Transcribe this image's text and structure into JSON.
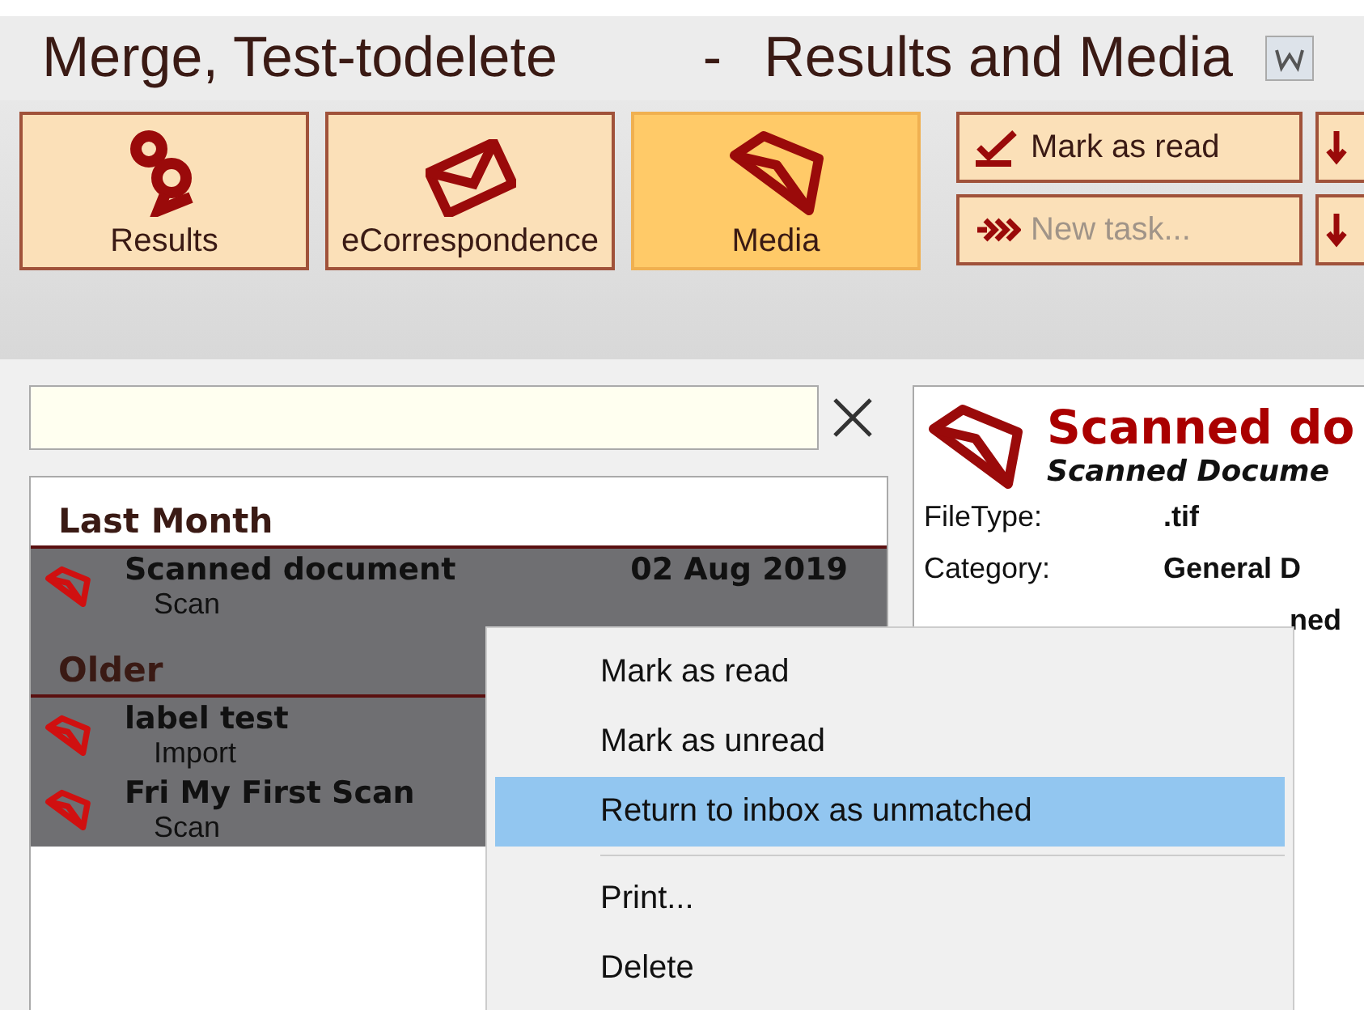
{
  "window": {
    "title": "Merge, Test-todelete",
    "subtitle": "Results and Media",
    "separator": "-"
  },
  "toolbar": {
    "big_buttons": [
      {
        "label": "Results",
        "selected": false
      },
      {
        "label": "eCorrespondence",
        "selected": false
      },
      {
        "label": "Media",
        "selected": true
      }
    ],
    "small_buttons": [
      {
        "label": "Mark as read",
        "disabled": false
      },
      {
        "label": "New task...",
        "disabled": true
      }
    ]
  },
  "list": {
    "sections": [
      {
        "title": "Last Month",
        "highlighted": false,
        "items": [
          {
            "title": "Scanned document",
            "subtitle": "Scan",
            "date": "02 Aug 2019",
            "selected": true
          }
        ]
      },
      {
        "title": "Older",
        "highlighted": true,
        "items": [
          {
            "title": "label test",
            "subtitle": "Import",
            "selected": true
          },
          {
            "title": "Fri My First Scan",
            "subtitle": "Scan",
            "selected": true
          }
        ]
      }
    ]
  },
  "detail": {
    "title": "Scanned do",
    "subtitle": "Scanned Docume",
    "fields": [
      {
        "label": "FileType:",
        "value": ".tif"
      },
      {
        "label": "Category:",
        "value": "General D"
      },
      {
        "value": "ned"
      }
    ]
  },
  "context_menu": {
    "items": [
      {
        "kind": "item",
        "label": "Mark as read",
        "selected": false
      },
      {
        "kind": "item",
        "label": "Mark as unread",
        "selected": false
      },
      {
        "kind": "item",
        "label": "Return to inbox as unmatched",
        "selected": true
      },
      {
        "kind": "separator"
      },
      {
        "kind": "item",
        "label": "Print...",
        "selected": false
      },
      {
        "kind": "item",
        "label": "Delete",
        "selected": false
      }
    ]
  }
}
